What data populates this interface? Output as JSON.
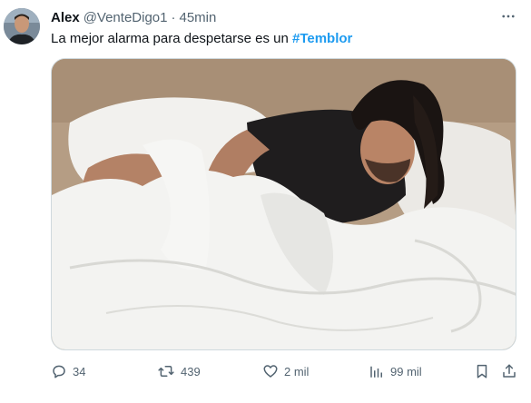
{
  "tweet": {
    "author": {
      "name": "Alex",
      "handle": "@VenteDigo1",
      "separator": "·",
      "time": "45min"
    },
    "text_prefix": "La mejor alarma para despetarse es un ",
    "hashtag": "#Temblor",
    "media": {
      "description_icon": "photo"
    },
    "actions": {
      "replies": "34",
      "retweets": "439",
      "likes": "2 mil",
      "views": "99 mil"
    },
    "icons": {
      "more": "more-icon",
      "reply": "reply-icon",
      "retweet": "retweet-icon",
      "like": "heart-icon",
      "views": "views-icon",
      "bookmark": "bookmark-icon",
      "share": "share-icon"
    },
    "colors": {
      "text": "#0f1419",
      "secondary": "#536471",
      "accent": "#1d9bf0"
    }
  }
}
